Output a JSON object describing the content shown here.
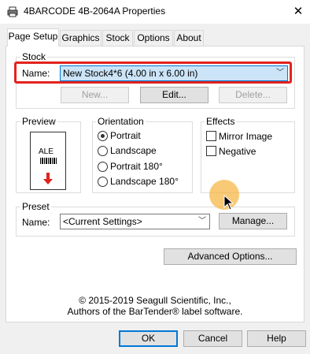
{
  "window": {
    "title": "4BARCODE 4B-2064A Properties",
    "close_glyph": "✕"
  },
  "tabs": [
    {
      "label": "Page Setup",
      "active": true
    },
    {
      "label": "Graphics"
    },
    {
      "label": "Stock"
    },
    {
      "label": "Options"
    },
    {
      "label": "About"
    }
  ],
  "stock": {
    "group_title": "Stock",
    "name_label": "Name:",
    "name_value": "New Stock4*6 (4.00 in x 6.00 in)",
    "buttons": {
      "new": "New...",
      "edit": "Edit...",
      "delete": "Delete..."
    }
  },
  "preview": {
    "group_title": "Preview",
    "label_text": "ALE"
  },
  "orientation": {
    "group_title": "Orientation",
    "options": [
      "Portrait",
      "Landscape",
      "Portrait 180°",
      "Landscape 180°"
    ],
    "selected": "Portrait"
  },
  "effects": {
    "group_title": "Effects",
    "options": [
      {
        "label": "Mirror Image",
        "checked": false
      },
      {
        "label": "Negative",
        "checked": false
      }
    ]
  },
  "preset": {
    "group_title": "Preset",
    "name_label": "Name:",
    "name_value": "<Current Settings>",
    "manage_label": "Manage..."
  },
  "advanced_options_label": "Advanced Options...",
  "copyright": {
    "line1": "© 2015-2019 Seagull Scientific, Inc.,",
    "line2": "Authors of the BarTender® label software."
  },
  "footer": {
    "ok": "OK",
    "cancel": "Cancel",
    "help": "Help"
  },
  "colors": {
    "highlight": "#e1231f",
    "accent": "#0078d7",
    "cursor_halo": "#f7b43c"
  }
}
